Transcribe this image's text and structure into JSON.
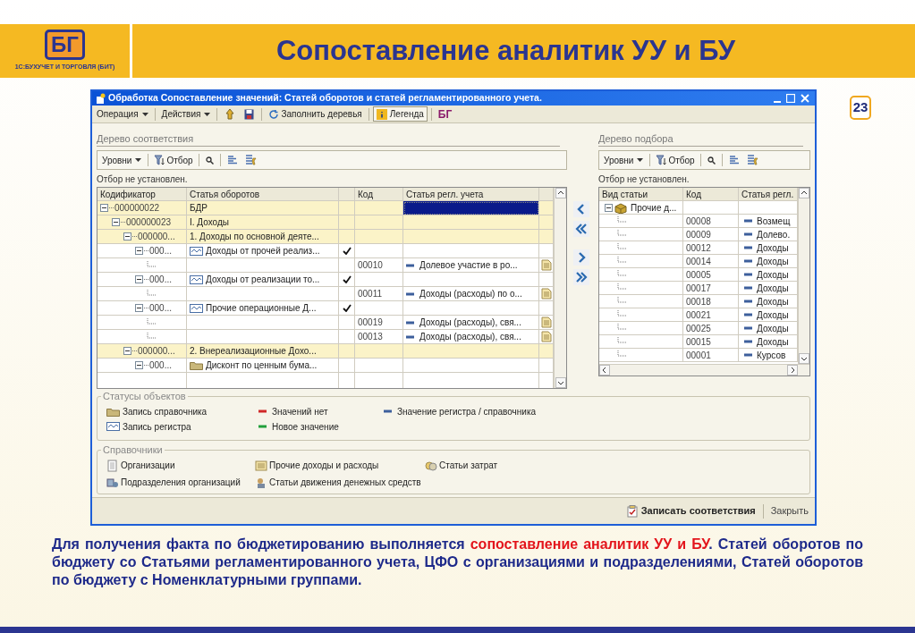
{
  "slide": {
    "logo_text": "БГ",
    "logo_caption": "1С:БУХУЧЕТ И ТОРГОВЛЯ (БИТ)",
    "title": "Сопоставление аналитик УУ и БУ",
    "page_number": "23"
  },
  "window": {
    "title": "Обработка  Сопоставление значений: Статей оборотов и статей регламентированного учета.",
    "toolbar": {
      "operation_menu": "Операция",
      "actions_menu": "Действия",
      "fill_button": "Заполнить деревья",
      "legend_button": {
        "label": "Легенда",
        "pressed": true
      },
      "logo_text": "БГ"
    },
    "left_panel": {
      "heading": "Дерево соответствия",
      "levels_menu": "Уровни",
      "filter_button": "Отбор",
      "filter_status": "Отбор не установлен.",
      "columns": [
        "Кодификатор",
        "Статья оборотов",
        "Код",
        "Статья регл. учета"
      ],
      "rows": [
        {
          "kind": "group",
          "code": "000000022",
          "name": "БДР",
          "expanded": true,
          "checked": false,
          "selected": true,
          "children": [
            {
              "kind": "group",
              "code": "000000023",
              "name": "I. Доходы",
              "expanded": true,
              "checked": false,
              "selected": false,
              "children": [
                {
                  "kind": "group",
                  "code": "000000...",
                  "name": "1. Доходы по основной деяте...",
                  "expanded": true,
                  "checked": false,
                  "selected": false,
                  "children": [
                    {
                      "kind": "register_entry",
                      "code": "000...",
                      "name": "Доходы от прочей реализ...",
                      "expanded": true,
                      "checked": true,
                      "selected": false,
                      "children": [
                        {
                          "kind": "value",
                          "reg_code": "00010",
                          "reg_item": "Долевое участие в ро...",
                          "checked": false,
                          "selected": false
                        }
                      ]
                    },
                    {
                      "kind": "register_entry",
                      "code": "000...",
                      "name": "Доходы от реализации то...",
                      "expanded": true,
                      "checked": true,
                      "selected": false,
                      "children": [
                        {
                          "kind": "value",
                          "reg_code": "00011",
                          "reg_item": "Доходы (расходы) по о...",
                          "checked": false,
                          "selected": false
                        }
                      ]
                    },
                    {
                      "kind": "register_entry",
                      "code": "000...",
                      "name": "Прочие операционные Д...",
                      "expanded": true,
                      "checked": true,
                      "selected": false,
                      "children": [
                        {
                          "kind": "value",
                          "reg_code": "00019",
                          "reg_item": "Доходы (расходы), свя...",
                          "checked": false,
                          "selected": false
                        },
                        {
                          "kind": "value",
                          "reg_code": "00013",
                          "reg_item": "Доходы (расходы), свя...",
                          "checked": false,
                          "selected": false
                        }
                      ]
                    }
                  ]
                },
                {
                  "kind": "group",
                  "code": "000000...",
                  "name": "2. Внереализационные  Дохо...",
                  "expanded": true,
                  "checked": false,
                  "selected": false,
                  "children": [
                    {
                      "kind": "catalog_entry",
                      "code": "000...",
                      "name": "Дисконт по ценным бума...",
                      "expanded": true,
                      "checked": false,
                      "selected": false
                    }
                  ]
                }
              ]
            }
          ]
        }
      ]
    },
    "right_panel": {
      "heading": "Дерево подбора",
      "levels_menu": "Уровни",
      "filter_button": "Отбор",
      "filter_status": "Отбор не установлен.",
      "columns": [
        "Вид статьи",
        "Код",
        "Статья регл."
      ],
      "rows": [
        {
          "kind": "group",
          "name": "Прочие д...",
          "expanded": true,
          "children": [
            {
              "kind": "value",
              "code": "00008",
              "item": "Возмещ"
            },
            {
              "kind": "value",
              "code": "00009",
              "item": "Долево."
            },
            {
              "kind": "value",
              "code": "00012",
              "item": "Доходы"
            },
            {
              "kind": "value",
              "code": "00014",
              "item": "Доходы"
            },
            {
              "kind": "value",
              "code": "00005",
              "item": "Доходы"
            },
            {
              "kind": "value",
              "code": "00017",
              "item": "Доходы"
            },
            {
              "kind": "value",
              "code": "00018",
              "item": "Доходы"
            },
            {
              "kind": "value",
              "code": "00021",
              "item": "Доходы"
            },
            {
              "kind": "value",
              "code": "00025",
              "item": "Доходы"
            },
            {
              "kind": "value",
              "code": "00015",
              "item": "Доходы"
            },
            {
              "kind": "value",
              "code": "00001",
              "item": "Курсов"
            }
          ]
        }
      ]
    },
    "statuses": {
      "title": "Статусы объектов",
      "items": [
        {
          "kind": "catalog_entry",
          "label": "Запись справочника"
        },
        {
          "kind": "dash",
          "color": "#d02828",
          "label": "Значений нет"
        },
        {
          "kind": "dash",
          "color": "#3d5f9c",
          "label": "Значение регистра / справочника"
        },
        {
          "kind": "register_entry",
          "label": "Запись регистра"
        },
        {
          "kind": "dash",
          "color": "#22a03c",
          "label": "Новое значение"
        }
      ]
    },
    "catalogs": {
      "title": "Справочники",
      "items": [
        "Организации",
        "Прочие доходы и расходы",
        "Статьи затрат",
        "Подразделения организаций",
        "Статьи движения денежных средств"
      ]
    },
    "footer": {
      "save_button": "Записать соответствия",
      "close_button": "Закрыть"
    }
  },
  "description": [
    {
      "text": "Для получения факта по бюджетированию выполняется ",
      "highlighted": false
    },
    {
      "text": "сопоставление аналитик УУ и БУ",
      "highlighted": true
    },
    {
      "text": ". Статей оборотов по бюджету со Статьями регламентированного учета, ЦФО с организациями и подразделениями, Статей оборотов по бюджету с Номенклатурными группами.",
      "highlighted": false
    }
  ]
}
